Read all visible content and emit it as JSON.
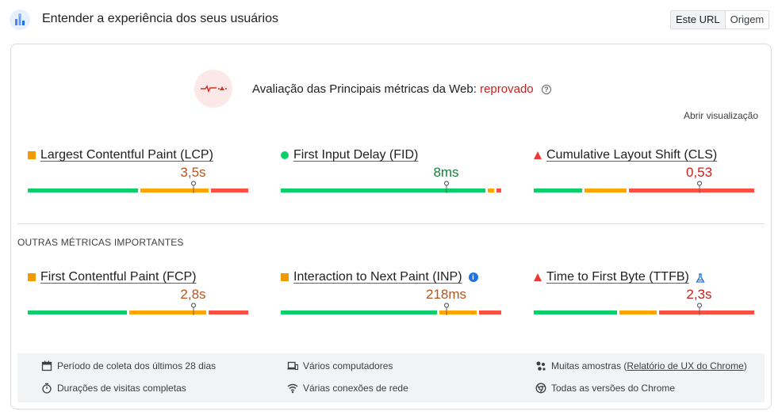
{
  "header": {
    "title": "Entender a experiência dos seus usuários",
    "toggle": {
      "url_label": "Este URL",
      "origin_label": "Origem",
      "selected": "Este URL"
    }
  },
  "assessment": {
    "label": "Avaliação das Principais métricas da Web:",
    "status": "reprovado",
    "help_icon": "question-circle-icon",
    "open_view": "Abrir visualização"
  },
  "core_metrics": [
    {
      "name": "Largest Contentful Paint (LCP)",
      "indicator": "square",
      "value": "3,5s",
      "rating": "needs-improvement",
      "distribution": {
        "good": 0.51,
        "needs_improvement": 0.32,
        "poor": 0.17
      },
      "p75": 0.75
    },
    {
      "name": "First Input Delay (FID)",
      "indicator": "circle",
      "value": "8ms",
      "rating": "good",
      "distribution": {
        "good": 0.94,
        "needs_improvement": 0.04,
        "poor": 0.02
      },
      "p75": 0.75
    },
    {
      "name": "Cumulative Layout Shift (CLS)",
      "indicator": "triangle",
      "value": "0,53",
      "rating": "poor",
      "distribution": {
        "good": 0.23,
        "needs_improvement": 0.2,
        "poor": 0.57
      },
      "p75": 0.75
    }
  ],
  "other_label": "OUTRAS MÉTRICAS IMPORTANTES",
  "other_metrics": [
    {
      "name": "First Contentful Paint (FCP)",
      "indicator": "square",
      "value": "2,8s",
      "rating": "needs-improvement",
      "distribution": {
        "good": 0.46,
        "needs_improvement": 0.36,
        "poor": 0.18
      },
      "p75": 0.75
    },
    {
      "name": "Interaction to Next Paint (INP)",
      "indicator": "square",
      "value": "218ms",
      "rating": "needs-improvement",
      "extra_icon": "info-icon",
      "distribution": {
        "good": 0.72,
        "needs_improvement": 0.18,
        "poor": 0.1
      },
      "p75": 0.75
    },
    {
      "name": "Time to First Byte (TTFB)",
      "indicator": "triangle",
      "value": "2,3s",
      "rating": "poor",
      "extra_icon": "flask-icon",
      "distribution": {
        "good": 0.39,
        "needs_improvement": 0.18,
        "poor": 0.43
      },
      "p75": 0.75
    }
  ],
  "footer": {
    "period": "Período de coleta dos últimos 28 dias",
    "visits": "Durações de visitas completas",
    "devices": "Vários computadores",
    "network": "Várias conexões de rede",
    "samples_prefix": "Muitas amostras (",
    "samples_link": "Relatório de UX do Chrome",
    "samples_suffix": ")",
    "chrome": "Todas as versões do Chrome"
  },
  "colors": {
    "good": "#0cce6b",
    "needs_improvement": "#ffa400",
    "poor": "#ff4e42",
    "fail_text": "#c5221f"
  }
}
